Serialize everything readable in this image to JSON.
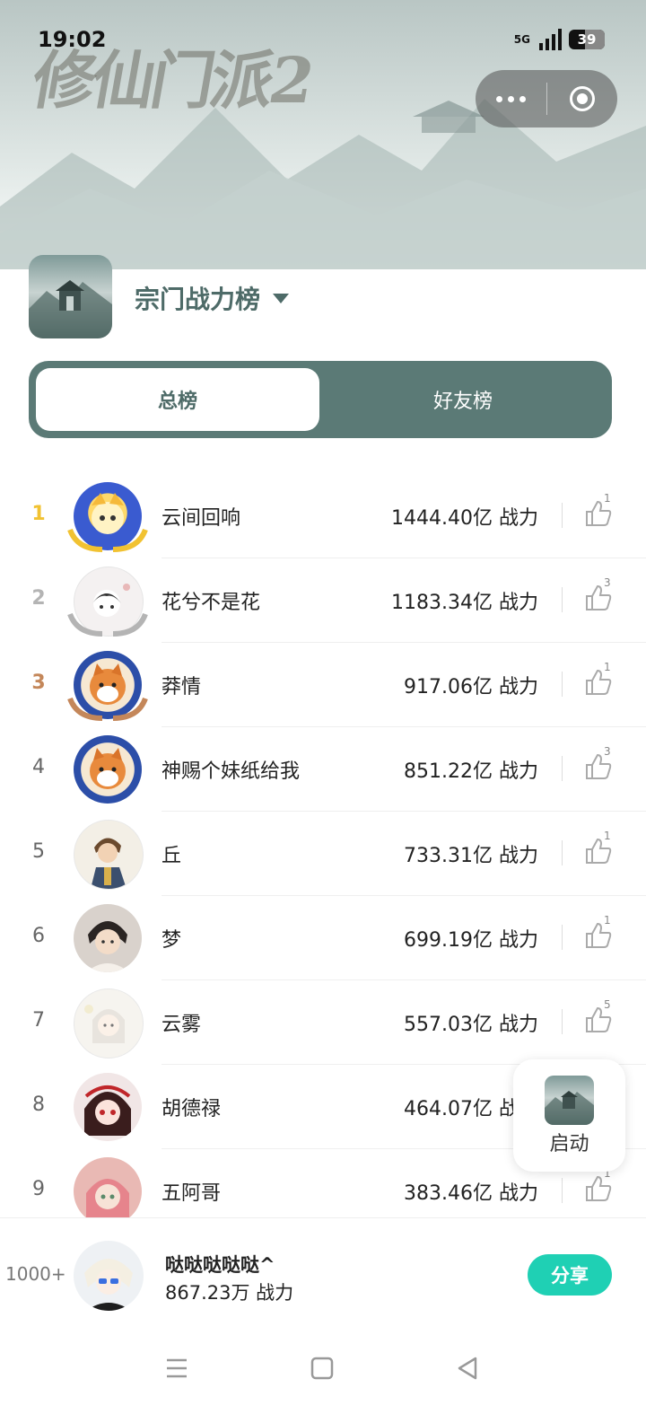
{
  "status_bar": {
    "time": "19:02",
    "network": "5G",
    "battery": "39"
  },
  "banner": {
    "game_title": "修仙门派2"
  },
  "capsule": {
    "more_icon": "more-dots-icon",
    "close_icon": "target-circle-icon"
  },
  "header": {
    "title": "宗门战力榜"
  },
  "tabs": [
    {
      "label": "总榜",
      "active": true
    },
    {
      "label": "好友榜",
      "active": false
    }
  ],
  "rankings": [
    {
      "rank": "1",
      "name": "云间回响",
      "power": "1444.40亿 战力",
      "likes": "1"
    },
    {
      "rank": "2",
      "name": "花兮不是花",
      "power": "1183.34亿 战力",
      "likes": "3"
    },
    {
      "rank": "3",
      "name": "莽情",
      "power": "917.06亿 战力",
      "likes": "1"
    },
    {
      "rank": "4",
      "name": "神赐个妹纸给我",
      "power": "851.22亿 战力",
      "likes": "3"
    },
    {
      "rank": "5",
      "name": "丘",
      "power": "733.31亿 战力",
      "likes": "1"
    },
    {
      "rank": "6",
      "name": "梦",
      "power": "699.19亿 战力",
      "likes": "1"
    },
    {
      "rank": "7",
      "name": "云雾",
      "power": "557.03亿 战力",
      "likes": "5"
    },
    {
      "rank": "8",
      "name": "胡德禄",
      "power": "464.07亿 战力",
      "likes": ""
    },
    {
      "rank": "9",
      "name": "五阿哥",
      "power": "383.46亿 战力",
      "likes": "1"
    }
  ],
  "launch": {
    "label": "启动"
  },
  "me": {
    "rank": "1000+",
    "name": "哒哒哒哒哒^",
    "power": "867.23万 战力",
    "share_label": "分享"
  },
  "colors": {
    "accent": "#5b7a76",
    "share": "#1fd0b4",
    "gold": "#f1c232",
    "silver": "#b4b4b4",
    "bronze": "#c4875a"
  }
}
